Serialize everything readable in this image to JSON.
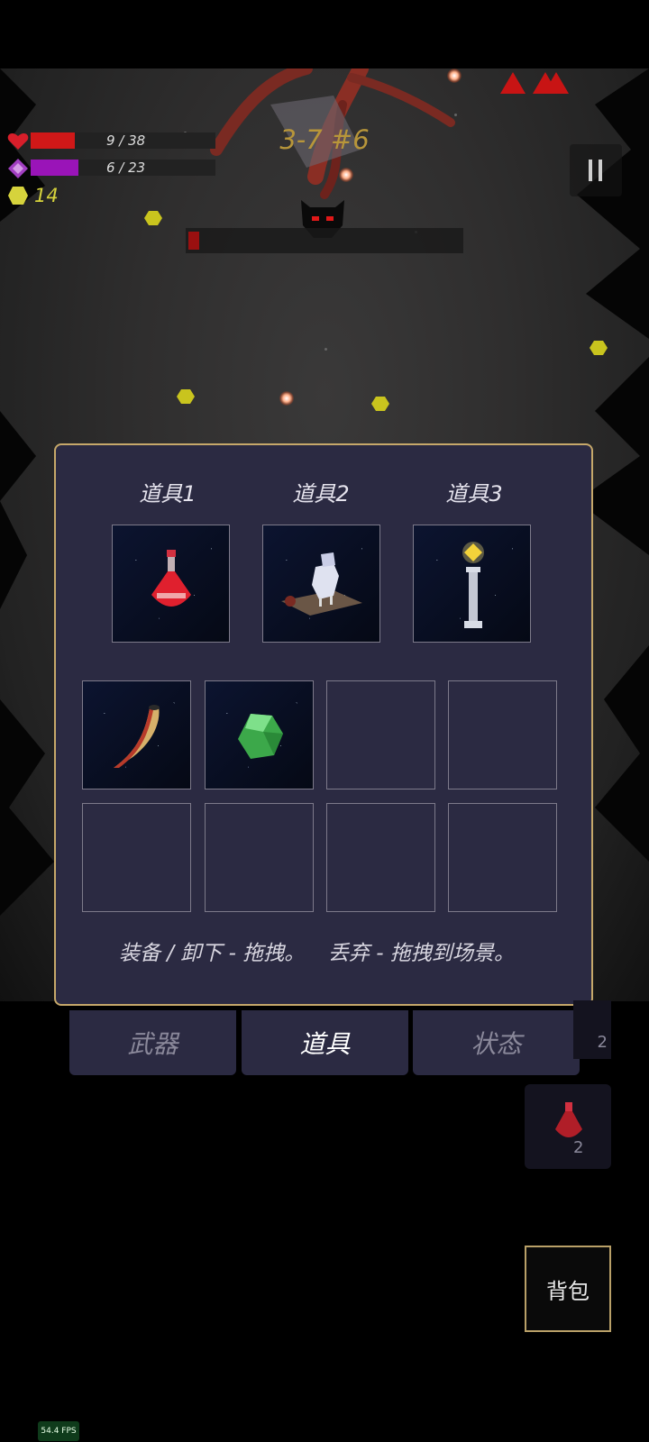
{
  "hud": {
    "hp_text": "9 / 38",
    "hp_fraction": 0.24,
    "mp_text": "6 / 23",
    "mp_fraction": 0.26,
    "coins": "14",
    "level": "3-7 #6",
    "boss_hp_fraction": 0.04,
    "pause_icon": "pause-icon"
  },
  "inventory": {
    "slot_titles": [
      "道具1",
      "道具2",
      "道具3"
    ],
    "equipped": [
      {
        "icon": "red-potion-icon"
      },
      {
        "icon": "scroll-totem-icon"
      },
      {
        "icon": "light-pillar-icon"
      }
    ],
    "bag_items": [
      {
        "icon": "horn-icon"
      },
      {
        "icon": "green-gem-icon"
      },
      {
        "icon": ""
      },
      {
        "icon": ""
      },
      {
        "icon": ""
      },
      {
        "icon": ""
      },
      {
        "icon": ""
      },
      {
        "icon": ""
      }
    ],
    "hint_equip": "装备 / 卸下 - 拖拽。",
    "hint_drop": "丢弃 - 拖拽到场景。"
  },
  "tabs": [
    {
      "label": "武器",
      "active": false
    },
    {
      "label": "道具",
      "active": true
    },
    {
      "label": "状态",
      "active": false
    }
  ],
  "side_items": [
    {
      "count": "2"
    },
    {
      "count": "2"
    }
  ],
  "bag_button": "背包",
  "fps": "54.4 FPS",
  "colors": {
    "hp": "#d01818",
    "mp": "#9a14b8",
    "coin": "#d6d33c",
    "panel_bg": "#2b2a42",
    "panel_border": "#c6a86a",
    "level_text": "#b8963a"
  }
}
